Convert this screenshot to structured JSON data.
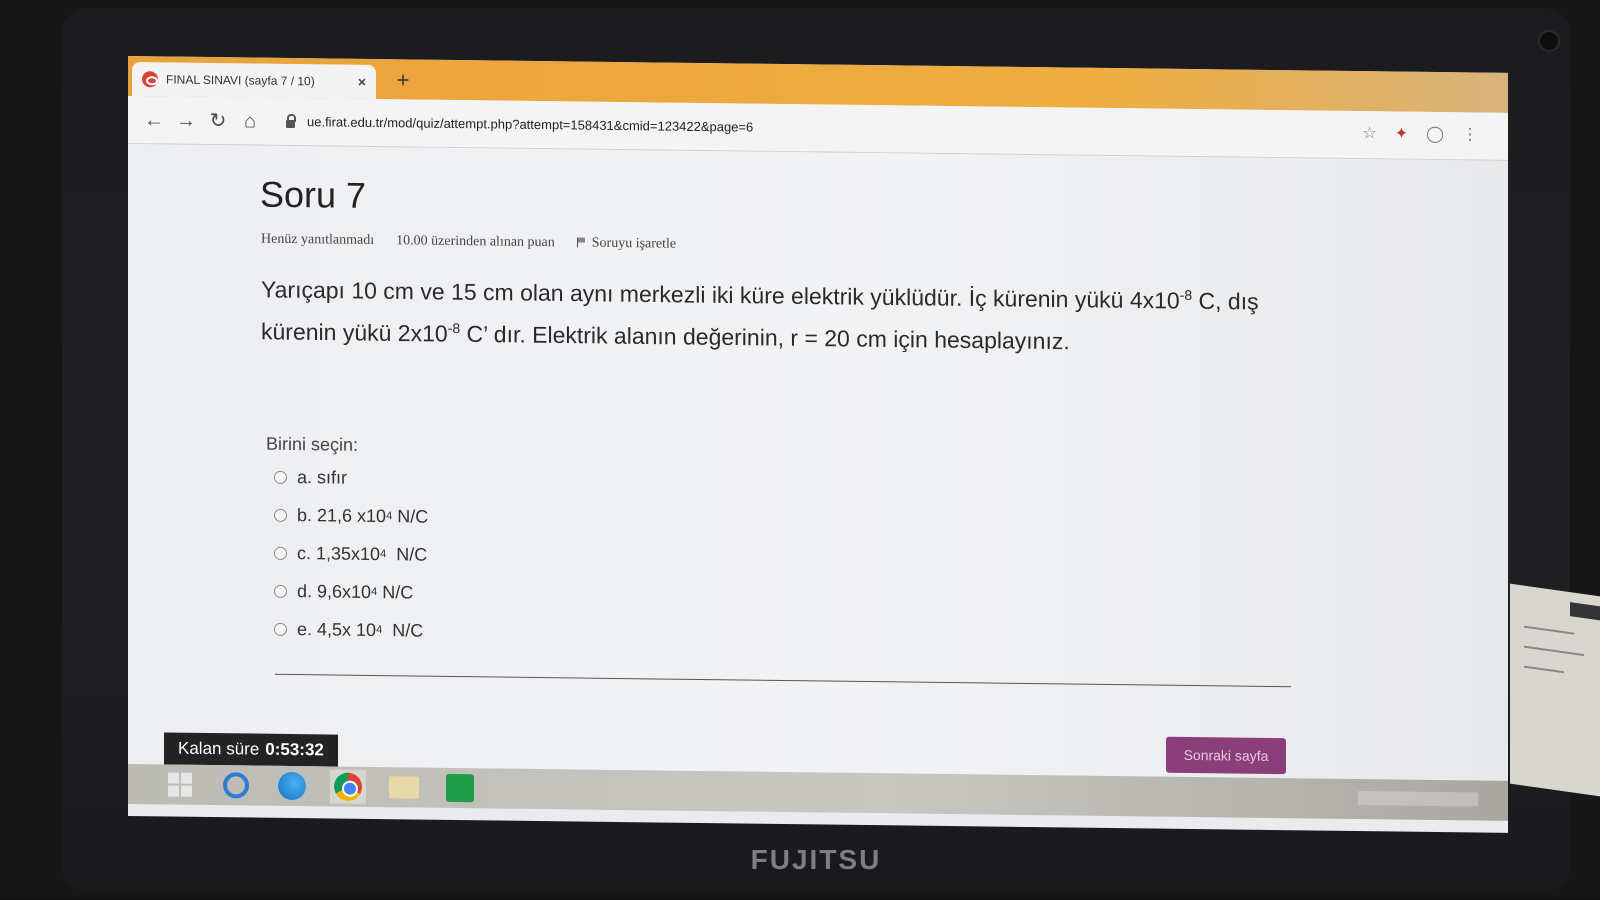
{
  "device": {
    "brand": "FUJITSU"
  },
  "browser": {
    "tab_title": "FINAL SINAVI (sayfa 7 / 10)",
    "tab_close": "×",
    "new_tab": "+",
    "url": "ue.firat.edu.tr/mod/quiz/attempt.php?attempt=158431&cmid=123422&page=6",
    "icons": [
      "back-icon",
      "forward-icon",
      "reload-icon",
      "home-icon",
      "lock-icon",
      "star-icon",
      "extension-icon",
      "profile-icon",
      "menu-icon"
    ]
  },
  "question": {
    "title": "Soru 7",
    "status": "Henüz yanıtlanmadı",
    "points": "10.00 üzerinden alınan puan",
    "flag_label": "Soruyu işaretle",
    "text_p1": "Yarıçapı 10 cm ve 15 cm olan aynı merkezli iki küre elektrik yüklüdür. İç kürenin yükü 4x10",
    "text_exp1": "-8",
    "text_p2": " C, dış kürenin yükü 2x10",
    "text_exp2": "-8",
    "text_p3": " C’ dır. Elektrik alanın değerinin, r = 20 cm için hesaplayınız.",
    "choose_label": "Birini seçin:",
    "answers": [
      {
        "base": "a. sıfır",
        "exp": "",
        "unit": ""
      },
      {
        "base": "b. 21,6 x10",
        "exp": "4",
        "unit": " N/C"
      },
      {
        "base": "c. 1,35x10",
        "exp": "4",
        "unit": "  N/C"
      },
      {
        "base": "d. 9,6x10",
        "exp": "4",
        "unit": " N/C"
      },
      {
        "base": "e. 4,5x 10",
        "exp": "4",
        "unit": "  N/C"
      }
    ]
  },
  "footer": {
    "timer_label": "Kalan süre",
    "timer_value": "0:53:32",
    "next_button": "Sonraki sayfa"
  },
  "taskbar": {
    "icons": [
      "windows-start-icon",
      "internet-explorer-icon",
      "edge-icon",
      "chrome-icon",
      "file-explorer-icon",
      "store-icon"
    ]
  }
}
